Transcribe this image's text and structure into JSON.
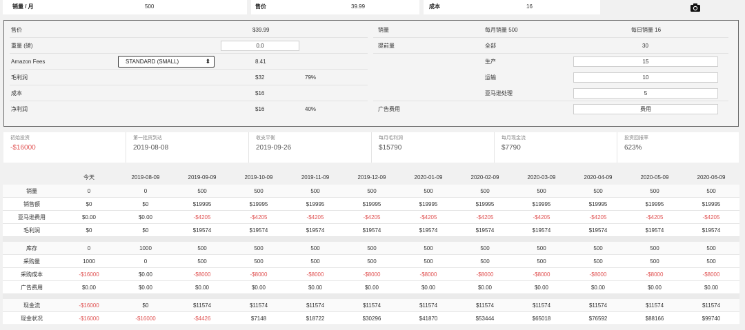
{
  "topbar": {
    "sales_label": "销量 / 月",
    "sales_value": "500",
    "price_label": "售价",
    "price_value": "39.99",
    "cost_label": "成本",
    "cost_value": "16",
    "camera_icon": "camera-icon"
  },
  "panel": {
    "price_label": "售价",
    "price_value": "$39.99",
    "weight_label": "重量 (磅)",
    "weight_value": "0.0",
    "fees_label": "Amazon Fees",
    "fees_select": "STANDARD (SMALL)",
    "fees_value": "8.41",
    "gross_label": "毛利润",
    "gross_value": "$32",
    "gross_pct": "79%",
    "cost_label": "成本",
    "cost_value": "$16",
    "net_label": "净利润",
    "net_value": "$16",
    "net_pct": "40%",
    "sales_label": "销量",
    "monthly_sales": "每月销量 500",
    "daily_sales": "每日销量 16",
    "lead_label": "提前量",
    "lead_all": "全部",
    "lead_all_value": "30",
    "prod_label": "生产",
    "prod_value": "15",
    "ship_label": "运输",
    "ship_value": "10",
    "amz_label": "亚马逊处理",
    "amz_value": "5",
    "ad_label": "广告费用",
    "ad_value": "费用"
  },
  "cards": [
    {
      "label": "初始投资",
      "value": "-$16000"
    },
    {
      "label": "第一批货到达",
      "value": "2019-08-08"
    },
    {
      "label": "收支平衡",
      "value": "2019-09-26"
    },
    {
      "label": "每月毛利润",
      "value": "$15790"
    },
    {
      "label": "每月现金流",
      "value": "$7790"
    },
    {
      "label": "投资回报率",
      "value": "623%"
    }
  ],
  "table": {
    "headers": [
      "",
      "今天",
      "2019-08-09",
      "2019-09-09",
      "2019-10-09",
      "2019-11-09",
      "2019-12-09",
      "2020-01-09",
      "2020-02-09",
      "2020-03-09",
      "2020-04-09",
      "2020-05-09",
      "2020-06-09"
    ],
    "groups": [
      [
        [
          "销量",
          "0",
          "0",
          "500",
          "500",
          "500",
          "500",
          "500",
          "500",
          "500",
          "500",
          "500",
          "500"
        ],
        [
          "销售额",
          "$0",
          "$0",
          "$19995",
          "$19995",
          "$19995",
          "$19995",
          "$19995",
          "$19995",
          "$19995",
          "$19995",
          "$19995",
          "$19995"
        ],
        [
          "亚马逊费用",
          "$0.00",
          "$0.00",
          "-$4205",
          "-$4205",
          "-$4205",
          "-$4205",
          "-$4205",
          "-$4205",
          "-$4205",
          "-$4205",
          "-$4205",
          "-$4205"
        ],
        [
          "毛利润",
          "$0",
          "$0",
          "$19574",
          "$19574",
          "$19574",
          "$19574",
          "$19574",
          "$19574",
          "$19574",
          "$19574",
          "$19574",
          "$19574"
        ]
      ],
      [
        [
          "库存",
          "0",
          "1000",
          "500",
          "500",
          "500",
          "500",
          "500",
          "500",
          "500",
          "500",
          "500",
          "500"
        ],
        [
          "采购量",
          "1000",
          "0",
          "500",
          "500",
          "500",
          "500",
          "500",
          "500",
          "500",
          "500",
          "500",
          "500"
        ],
        [
          "采购成本",
          "-$16000",
          "$0.00",
          "-$8000",
          "-$8000",
          "-$8000",
          "-$8000",
          "-$8000",
          "-$8000",
          "-$8000",
          "-$8000",
          "-$8000",
          "-$8000"
        ],
        [
          "广告费用",
          "$0.00",
          "$0.00",
          "$0.00",
          "$0.00",
          "$0.00",
          "$0.00",
          "$0.00",
          "$0.00",
          "$0.00",
          "$0.00",
          "$0.00",
          "$0.00"
        ]
      ],
      [
        [
          "现金流",
          "-$16000",
          "$0",
          "$11574",
          "$11574",
          "$11574",
          "$11574",
          "$11574",
          "$11574",
          "$11574",
          "$11574",
          "$11574",
          "$11574"
        ],
        [
          "现金状况",
          "-$16000",
          "-$16000",
          "-$4426",
          "$7148",
          "$18722",
          "$30296",
          "$41870",
          "$53444",
          "$65018",
          "$76592",
          "$88166",
          "$99740"
        ]
      ]
    ]
  },
  "colors": {
    "negative": "#e05252",
    "border": "#6a6a6a"
  }
}
